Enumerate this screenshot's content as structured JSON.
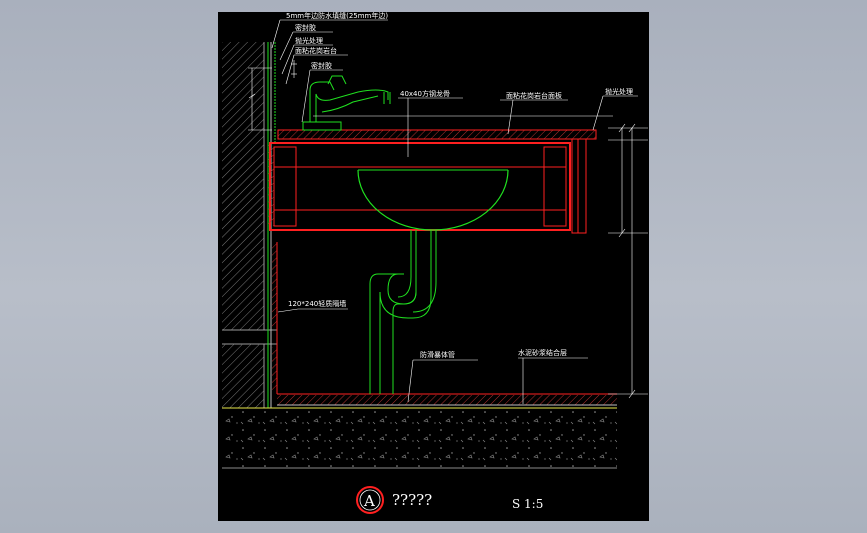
{
  "drawing": {
    "labels": {
      "waterproof_top": "5mm年边防水填缝(25mm年边)",
      "sealant_1": "密封胶",
      "polish_1": "抛光处理",
      "stone_slab_1": "面粘花岗岩台",
      "sealant_2": "密封胶",
      "steel_frame": "40x40方钢龙骨",
      "countertop": "面粘花岗岩台面板",
      "polish_2": "抛光处理",
      "side_pipe": "120*240轻质隔墙",
      "trap": "防滑暴体管",
      "floor_layer": "水泥砂浆结合层"
    },
    "title_circle": "A",
    "title_text": "?????",
    "scale_text": "S 1:5"
  },
  "colors": {
    "background": "#000000",
    "red": "#ff2020",
    "green": "#20e020",
    "white": "#ffffff",
    "gray": "#8a8a8a",
    "yellow": "#e8e84a"
  }
}
